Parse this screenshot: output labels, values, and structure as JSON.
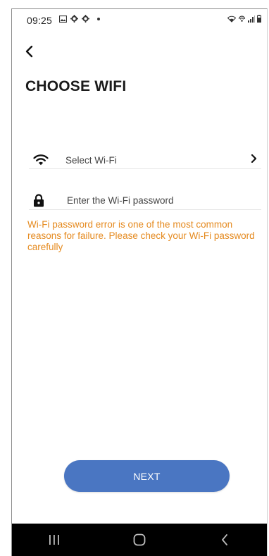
{
  "status_bar": {
    "time": "09:25",
    "left_icons": [
      "gallery-icon",
      "gear-icon",
      "gear-icon",
      "dot-icon"
    ],
    "right_icons": [
      "wifi-status-icon",
      "hotspot-icon",
      "signal-icon",
      "battery-icon"
    ]
  },
  "page": {
    "title": "CHOOSE WIFI"
  },
  "wifi_row": {
    "label": "Select Wi-Fi",
    "icon": "wifi-icon",
    "chevron_icon": "chevron-right-icon"
  },
  "password_row": {
    "placeholder": "Enter the Wi-Fi password",
    "value": "",
    "icon": "lock-icon"
  },
  "warning": {
    "text": "Wi-Fi password error is one of the most common reasons for failure. Please check your Wi-Fi password carefully",
    "color": "#e58a1f"
  },
  "next_button": {
    "label": "NEXT",
    "color": "#4a76c2"
  },
  "nav_bar": {
    "icons": [
      "recent-apps-icon",
      "home-icon",
      "back-nav-icon"
    ]
  }
}
